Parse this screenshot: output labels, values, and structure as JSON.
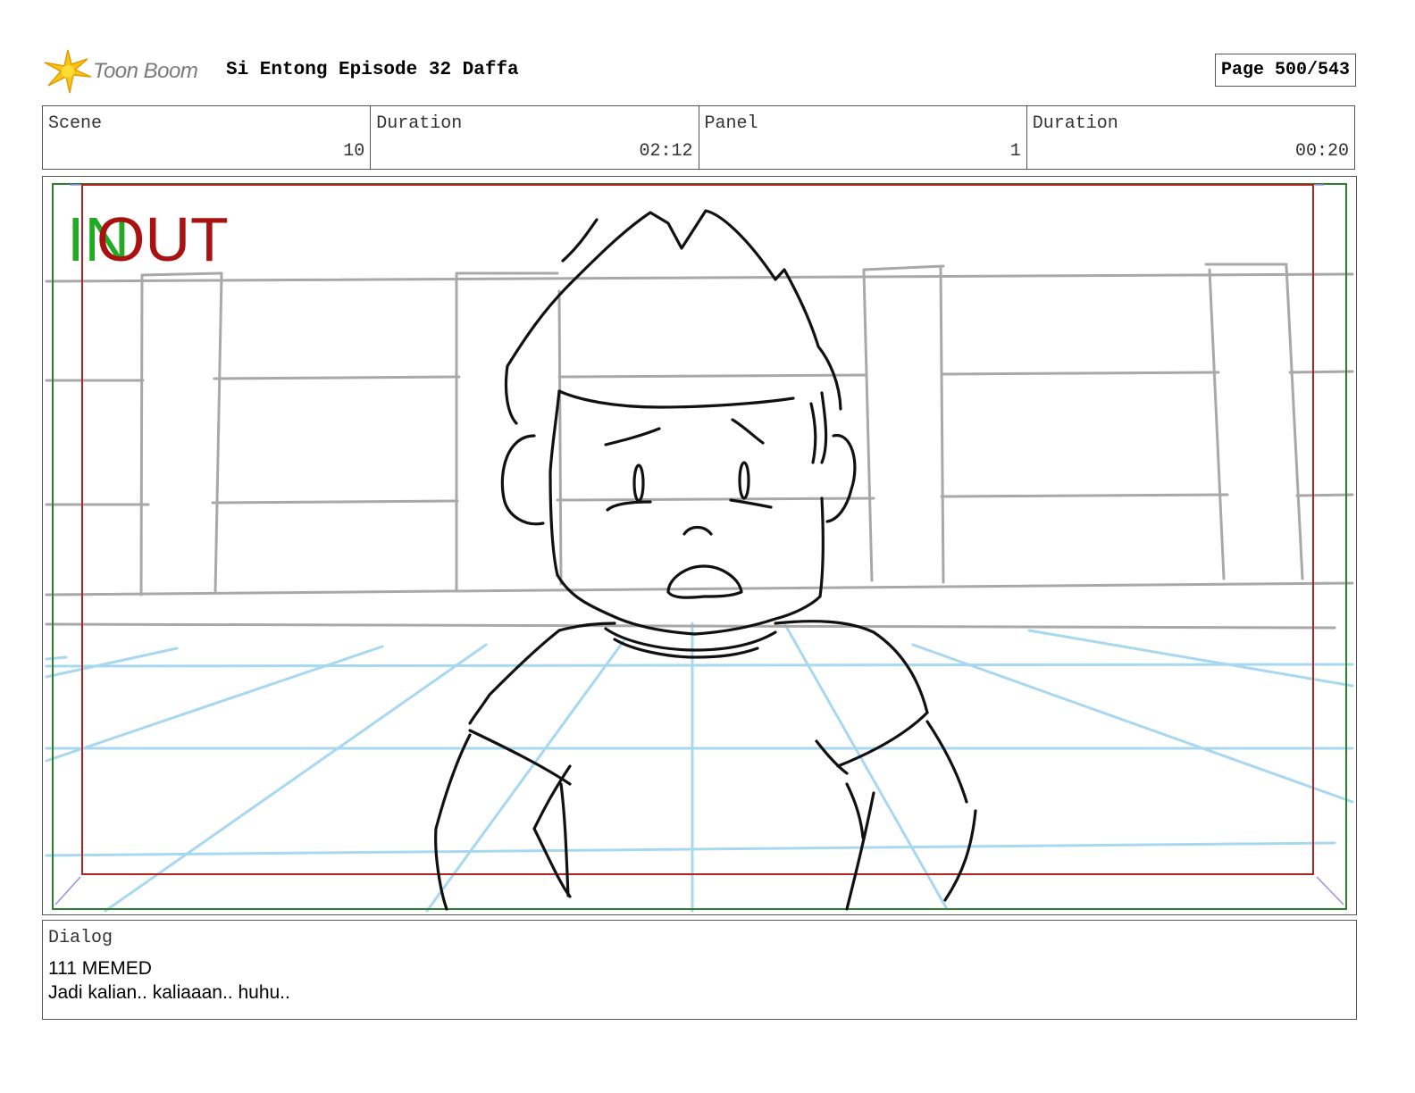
{
  "header": {
    "logo_text": "Toon Boom",
    "project_title": "Si Entong Episode 32 Daffa",
    "page_label": "Page 500/543"
  },
  "info": {
    "scene_label": "Scene",
    "scene_value": "10",
    "scene_duration_label": "Duration",
    "scene_duration_value": "02:12",
    "panel_label": "Panel",
    "panel_value": "1",
    "panel_duration_label": "Duration",
    "panel_duration_value": "00:20"
  },
  "panel": {
    "in_marker": "IN",
    "out_marker": "OUT",
    "colors": {
      "in": "#22aa22",
      "out": "#aa1111",
      "safe_frame_outer": "#2e7d32",
      "safe_frame_inner": "#b22222",
      "background_lines": "#a8a8a8",
      "perspective_grid": "#a8d8f0",
      "character_lines": "#111111"
    }
  },
  "dialog": {
    "label": "Dialog",
    "speaker": "111 MEMED",
    "line": "Jadi kalian.. kaliaaan.. huhu.."
  }
}
